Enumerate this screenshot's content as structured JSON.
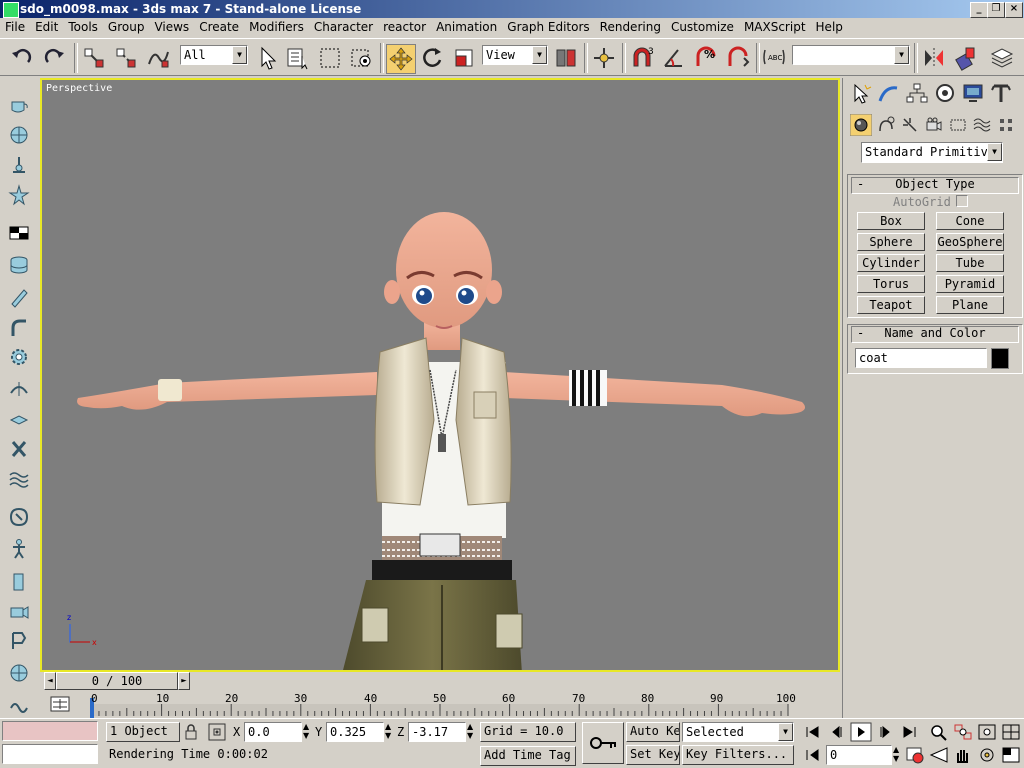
{
  "window": {
    "title": "sdo_m0098.max - 3ds max 7 - Stand-alone License"
  },
  "menu": [
    "File",
    "Edit",
    "Tools",
    "Group",
    "Views",
    "Create",
    "Modifiers",
    "Character",
    "reactor",
    "Animation",
    "Graph Editors",
    "Rendering",
    "Customize",
    "MAXScript",
    "Help"
  ],
  "toolbar": {
    "selection_filter": "All",
    "reference_coord": "View",
    "named_selection": ""
  },
  "viewport": {
    "label": "Perspective"
  },
  "command_panel": {
    "category_dropdown": "Standard Primitiv",
    "object_type": {
      "title": "Object Type",
      "autogrid_label": "AutoGrid",
      "autogrid_checked": false,
      "buttons": [
        "Box",
        "Cone",
        "Sphere",
        "GeoSphere",
        "Cylinder",
        "Tube",
        "Torus",
        "Pyramid",
        "Teapot",
        "Plane"
      ]
    },
    "name_color": {
      "title": "Name and Color",
      "name": "coat",
      "color": "#000000"
    }
  },
  "time_slider": {
    "label": "0 / 100",
    "current": 0,
    "total": 100
  },
  "track": {
    "ticks": [
      "0",
      "10",
      "20",
      "30",
      "40",
      "50",
      "60",
      "70",
      "80",
      "90",
      "100"
    ]
  },
  "status": {
    "selection_count": "1 Object",
    "x_label": "X",
    "x": "0.0",
    "y_label": "Y",
    "y": "0.325",
    "z_label": "Z",
    "z": "-3.17",
    "grid": "Grid = 10.0",
    "auto_key": "Auto Key",
    "set_key": "Set Key",
    "key_mode": "Selected",
    "key_filters": "Key Filters...",
    "frame": "0",
    "prompt": "Rendering Time  0:00:02",
    "add_time_tag": "Add Time Tag"
  },
  "colors": {
    "viewport_bg": "#7e7e7e",
    "active_border": "#e8e826",
    "axis_x": "#cc0000",
    "axis_z": "#0000cc"
  }
}
